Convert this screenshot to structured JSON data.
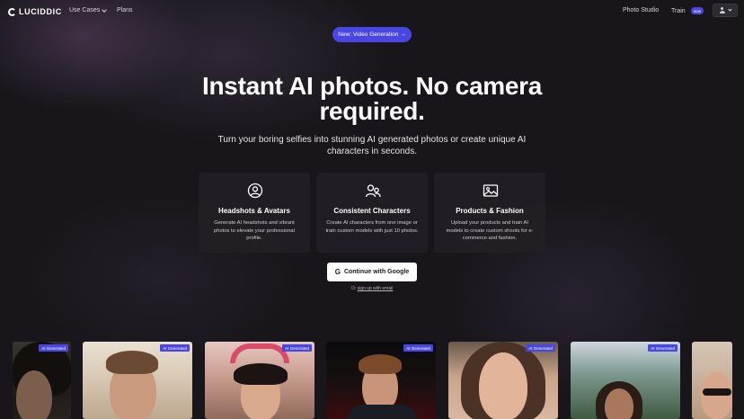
{
  "nav": {
    "logo": "LUCIDDIC",
    "use_cases": "Use Cases",
    "plans": "Plans",
    "photo_studio": "Photo Studio",
    "train": "Train",
    "train_badge": "new"
  },
  "announcement": "New: Video Generation →",
  "hero": {
    "title_line1": "Instant AI photos. No camera",
    "title_line2": "required.",
    "subtitle": "Turn your boring selfies into stunning AI generated photos or create unique AI characters in seconds."
  },
  "features": [
    {
      "icon": "user-circle-icon",
      "title": "Headshots & Avatars",
      "description": "Generate AI headshots and vibrant photos to elevate your professional profile."
    },
    {
      "icon": "users-icon",
      "title": "Consistent Characters",
      "description": "Create AI characters from one image or train custom models with just 10 photos."
    },
    {
      "icon": "image-icon",
      "title": "Products & Fashion",
      "description": "Upload your products and train AI models to create custom shoots for e-commerce and fashion."
    }
  ],
  "cta": {
    "google_button": "Continue with Google",
    "or_text": "Or ",
    "email_link": "sign up with email"
  },
  "gallery": {
    "tag": "AI Generated"
  },
  "colors": {
    "accent": "#4a46e4",
    "background": "#18161b",
    "card": "#222025"
  }
}
